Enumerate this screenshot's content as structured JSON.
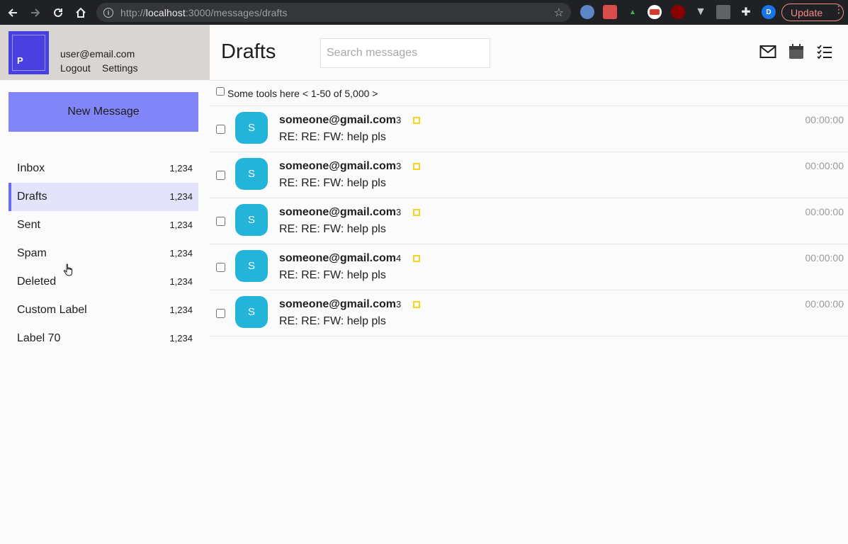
{
  "browser": {
    "url_scheme": "http://",
    "url_host": "localhost",
    "url_path": ":3000/messages/drafts",
    "profile_initial": "D",
    "update_label": "Update"
  },
  "account": {
    "avatar_letter": "P",
    "email": "user@email.com",
    "logout_label": "Logout",
    "settings_label": "Settings"
  },
  "sidebar": {
    "new_message_label": "New Message",
    "labels": [
      {
        "label": "Inbox",
        "count": "1,234"
      },
      {
        "label": "Drafts",
        "count": "1,234"
      },
      {
        "label": "Sent",
        "count": "1,234"
      },
      {
        "label": "Spam",
        "count": "1,234"
      },
      {
        "label": "Deleted",
        "count": "1,234"
      },
      {
        "label": "Custom Label",
        "count": "1,234"
      },
      {
        "label": "Label 70",
        "count": "1,234"
      }
    ],
    "active_label": "Drafts"
  },
  "header": {
    "title": "Drafts",
    "search_placeholder": "Search messages",
    "icons": [
      "mail-icon",
      "calendar-icon",
      "tasks-icon"
    ]
  },
  "toolbar": {
    "text": "Some tools here < 1-50 of 5,000 >"
  },
  "messages": [
    {
      "avatar": "S",
      "sender": "someone@gmail.com",
      "count": "3",
      "subject": "RE: RE: FW: help pls",
      "time": "00:00:00"
    },
    {
      "avatar": "S",
      "sender": "someone@gmail.com",
      "count": "3",
      "subject": "RE: RE: FW: help pls",
      "time": "00:00:00"
    },
    {
      "avatar": "S",
      "sender": "someone@gmail.com",
      "count": "3",
      "subject": "RE: RE: FW: help pls",
      "time": "00:00:00"
    },
    {
      "avatar": "S",
      "sender": "someone@gmail.com",
      "count": "4",
      "subject": "RE: RE: FW: help pls",
      "time": "00:00:00"
    },
    {
      "avatar": "S",
      "sender": "someone@gmail.com",
      "count": "3",
      "subject": "RE: RE: FW: help pls",
      "time": "00:00:00"
    }
  ],
  "colors": {
    "accent": "#8185f7",
    "avatar": "#23b4d9",
    "flag": "#f7d51d",
    "account_bg": "#d9d5d2"
  }
}
